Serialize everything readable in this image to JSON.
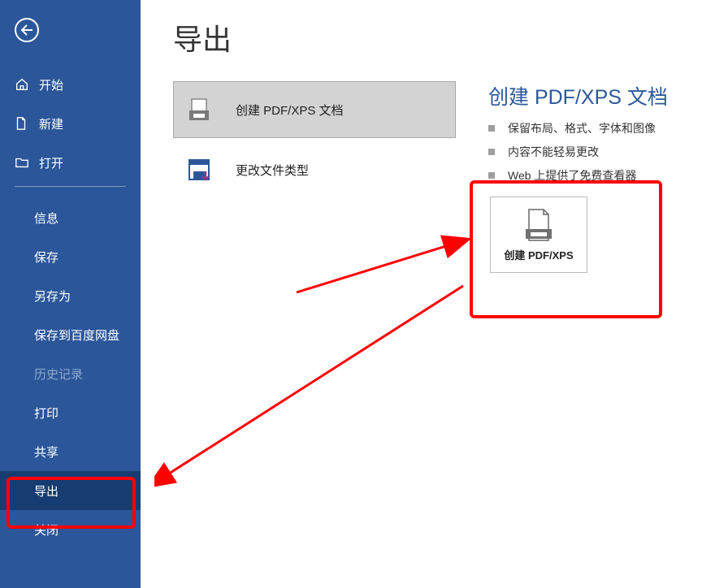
{
  "sidebar": {
    "items": [
      {
        "label": "开始",
        "icon": "home-icon"
      },
      {
        "label": "新建",
        "icon": "document-icon"
      },
      {
        "label": "打开",
        "icon": "folder-icon"
      }
    ],
    "items2": [
      {
        "label": "信息"
      },
      {
        "label": "保存"
      },
      {
        "label": "另存为"
      },
      {
        "label": "保存到百度网盘"
      },
      {
        "label": "历史记录",
        "disabled": true
      },
      {
        "label": "打印"
      },
      {
        "label": "共享"
      },
      {
        "label": "导出",
        "selected": true
      },
      {
        "label": "关闭"
      }
    ]
  },
  "page": {
    "title": "导出",
    "options": [
      {
        "label": "创建 PDF/XPS 文档",
        "icon": "pdf-icon",
        "selected": true
      },
      {
        "label": "更改文件类型",
        "icon": "save-as-icon"
      }
    ]
  },
  "detail": {
    "title": "创建 PDF/XPS 文档",
    "bullets": [
      "保留布局、格式、字体和图像",
      "内容不能轻易更改",
      "Web 上提供了免费查看器"
    ],
    "button_label": "创建 PDF/XPS"
  }
}
